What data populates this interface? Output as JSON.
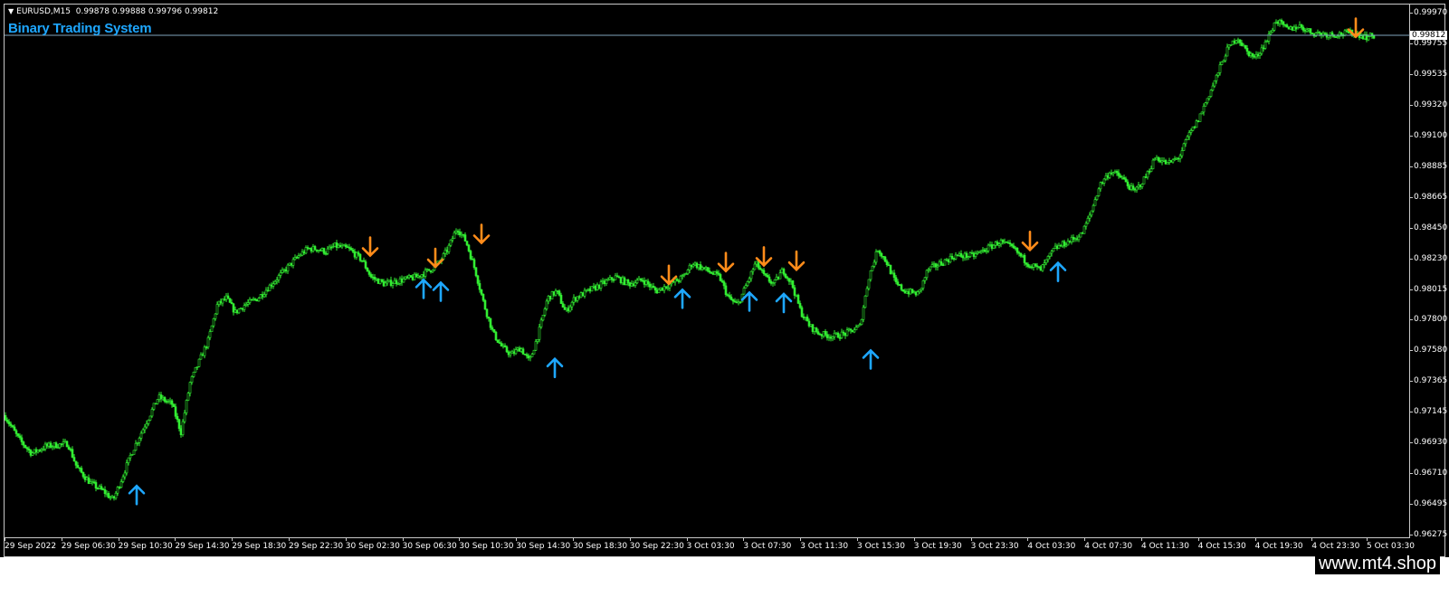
{
  "header": {
    "symbol": "EURUSD,M15",
    "ohlc": "0.99878 0.99888 0.99796 0.99812"
  },
  "indicator": {
    "title": "Binary Trading System"
  },
  "watermark": "www.mt4.shop",
  "colors": {
    "background": "#000000",
    "candle": "#33ee33",
    "up_arrow": "#1ea7ff",
    "down_arrow": "#ff8c1a",
    "title": "#1ea7ff",
    "bid_line": "#7fa5bd"
  },
  "chart_data": {
    "type": "candlestick",
    "ylim": [
      0.9625,
      1.0003
    ],
    "y_ticks": [
      "0.99970",
      "0.99755",
      "0.99535",
      "0.99320",
      "0.99100",
      "0.98885",
      "0.98665",
      "0.98450",
      "0.98230",
      "0.98015",
      "0.97800",
      "0.97580",
      "0.97365",
      "0.97145",
      "0.96930",
      "0.96710",
      "0.96495",
      "0.96275"
    ],
    "y_tick_values": [
      0.9997,
      0.99755,
      0.99535,
      0.9932,
      0.991,
      0.98885,
      0.98665,
      0.9845,
      0.9823,
      0.98015,
      0.978,
      0.9758,
      0.97365,
      0.97145,
      0.9693,
      0.9671,
      0.96495,
      0.96275
    ],
    "current_price_label": "0.99812",
    "current_price": 0.99812,
    "x_ticks": [
      "29 Sep 2022",
      "29 Sep 06:30",
      "29 Sep 10:30",
      "29 Sep 14:30",
      "29 Sep 18:30",
      "29 Sep 22:30",
      "30 Sep 02:30",
      "30 Sep 06:30",
      "30 Sep 10:30",
      "30 Sep 14:30",
      "30 Sep 18:30",
      "30 Sep 22:30",
      "3 Oct 03:30",
      "3 Oct 07:30",
      "3 Oct 11:30",
      "3 Oct 15:30",
      "3 Oct 19:30",
      "3 Oct 23:30",
      "4 Oct 03:30",
      "4 Oct 07:30",
      "4 Oct 11:30",
      "4 Oct 15:30",
      "4 Oct 19:30",
      "4 Oct 23:30",
      "5 Oct 03:30"
    ],
    "price_path": [
      [
        0,
        0.9712
      ],
      [
        16,
        0.9695
      ],
      [
        30,
        0.9685
      ],
      [
        45,
        0.969
      ],
      [
        70,
        0.9692
      ],
      [
        80,
        0.9675
      ],
      [
        95,
        0.9664
      ],
      [
        110,
        0.9658
      ],
      [
        120,
        0.9652
      ],
      [
        130,
        0.9668
      ],
      [
        140,
        0.9685
      ],
      [
        155,
        0.9705
      ],
      [
        170,
        0.9725
      ],
      [
        185,
        0.972
      ],
      [
        195,
        0.97
      ],
      [
        205,
        0.9735
      ],
      [
        215,
        0.975
      ],
      [
        225,
        0.9765
      ],
      [
        235,
        0.979
      ],
      [
        245,
        0.9795
      ],
      [
        255,
        0.9785
      ],
      [
        265,
        0.979
      ],
      [
        280,
        0.9795
      ],
      [
        295,
        0.9805
      ],
      [
        310,
        0.9815
      ],
      [
        325,
        0.9825
      ],
      [
        335,
        0.983
      ],
      [
        345,
        0.983
      ],
      [
        355,
        0.9828
      ],
      [
        365,
        0.9832
      ],
      [
        380,
        0.983
      ],
      [
        395,
        0.9822
      ],
      [
        405,
        0.981
      ],
      [
        420,
        0.9805
      ],
      [
        440,
        0.9808
      ],
      [
        455,
        0.981
      ],
      [
        470,
        0.9815
      ],
      [
        480,
        0.982
      ],
      [
        490,
        0.983
      ],
      [
        500,
        0.9845
      ],
      [
        510,
        0.9835
      ],
      [
        520,
        0.9815
      ],
      [
        530,
        0.979
      ],
      [
        540,
        0.977
      ],
      [
        550,
        0.976
      ],
      [
        560,
        0.9755
      ],
      [
        570,
        0.976
      ],
      [
        580,
        0.975
      ],
      [
        590,
        0.977
      ],
      [
        600,
        0.9795
      ],
      [
        610,
        0.98
      ],
      [
        620,
        0.9785
      ],
      [
        630,
        0.9795
      ],
      [
        645,
        0.98
      ],
      [
        660,
        0.9805
      ],
      [
        675,
        0.981
      ],
      [
        690,
        0.9805
      ],
      [
        705,
        0.9808
      ],
      [
        720,
        0.98
      ],
      [
        735,
        0.9805
      ],
      [
        750,
        0.981
      ],
      [
        760,
        0.982
      ],
      [
        775,
        0.9815
      ],
      [
        790,
        0.981
      ],
      [
        800,
        0.9795
      ],
      [
        810,
        0.979
      ],
      [
        820,
        0.9805
      ],
      [
        830,
        0.982
      ],
      [
        840,
        0.981
      ],
      [
        850,
        0.9805
      ],
      [
        860,
        0.9815
      ],
      [
        870,
        0.9805
      ],
      [
        880,
        0.9785
      ],
      [
        890,
        0.9775
      ],
      [
        900,
        0.977
      ],
      [
        915,
        0.9768
      ],
      [
        930,
        0.977
      ],
      [
        945,
        0.9775
      ],
      [
        955,
        0.981
      ],
      [
        965,
        0.983
      ],
      [
        975,
        0.982
      ],
      [
        985,
        0.9805
      ],
      [
        995,
        0.98
      ],
      [
        1010,
        0.9798
      ],
      [
        1020,
        0.9815
      ],
      [
        1035,
        0.982
      ],
      [
        1050,
        0.9825
      ],
      [
        1070,
        0.9825
      ],
      [
        1085,
        0.983
      ],
      [
        1100,
        0.9835
      ],
      [
        1115,
        0.983
      ],
      [
        1130,
        0.982
      ],
      [
        1145,
        0.9815
      ],
      [
        1160,
        0.983
      ],
      [
        1175,
        0.9835
      ],
      [
        1190,
        0.984
      ],
      [
        1200,
        0.9855
      ],
      [
        1210,
        0.9875
      ],
      [
        1222,
        0.9885
      ],
      [
        1235,
        0.988
      ],
      [
        1248,
        0.987
      ],
      [
        1260,
        0.988
      ],
      [
        1272,
        0.9895
      ],
      [
        1285,
        0.989
      ],
      [
        1298,
        0.9895
      ],
      [
        1308,
        0.991
      ],
      [
        1318,
        0.992
      ],
      [
        1328,
        0.9935
      ],
      [
        1338,
        0.995
      ],
      [
        1350,
        0.997
      ],
      [
        1362,
        0.998
      ],
      [
        1372,
        0.997
      ],
      [
        1382,
        0.9965
      ],
      [
        1395,
        0.9978
      ],
      [
        1405,
        0.9992
      ],
      [
        1418,
        0.9985
      ],
      [
        1430,
        0.9988
      ],
      [
        1445,
        0.9983
      ],
      [
        1460,
        0.9982
      ],
      [
        1475,
        0.9982
      ],
      [
        1490,
        0.9983
      ],
      [
        1505,
        0.998
      ],
      [
        1515,
        0.99812
      ]
    ],
    "up_arrows": [
      [
        146,
        0.9662
      ],
      [
        463,
        0.9808
      ],
      [
        482,
        0.9806
      ],
      [
        608,
        0.9752
      ],
      [
        749,
        0.9801
      ],
      [
        823,
        0.9799
      ],
      [
        861,
        0.9798
      ],
      [
        957,
        0.9758
      ],
      [
        1164,
        0.982
      ]
    ],
    "down_arrows": [
      [
        404,
        0.9838
      ],
      [
        476,
        0.983
      ],
      [
        527,
        0.9847
      ],
      [
        734,
        0.9818
      ],
      [
        797,
        0.9827
      ],
      [
        839,
        0.9831
      ],
      [
        875,
        0.9828
      ],
      [
        1133,
        0.9842
      ],
      [
        1493,
        0.9993
      ]
    ]
  }
}
